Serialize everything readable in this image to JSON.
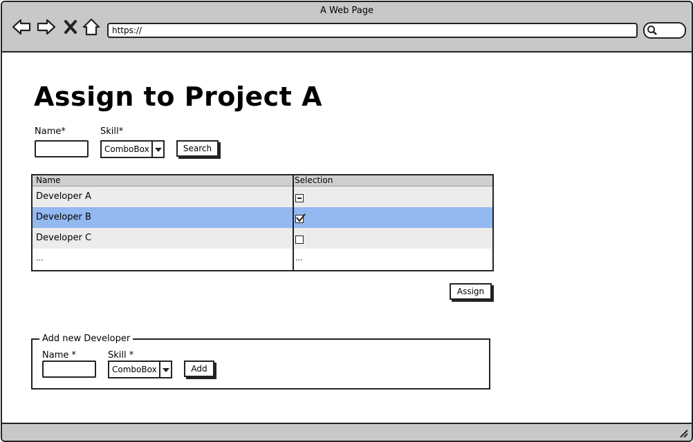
{
  "window": {
    "title": "A Web Page",
    "url": "https://"
  },
  "page": {
    "heading": "Assign to Project A"
  },
  "search": {
    "name_label": "Name*",
    "skill_label": "Skill*",
    "skill_value": "ComboBox",
    "search_label": "Search"
  },
  "table": {
    "columns": [
      "Name",
      "Selection"
    ],
    "rows": [
      {
        "name": "Developer A",
        "selection": "indeterminate",
        "selected": false
      },
      {
        "name": "Developer B",
        "selection": "checked",
        "selected": true
      },
      {
        "name": "Developer C",
        "selection": "unchecked",
        "selected": false
      },
      {
        "name": "...",
        "selection_text": "..."
      }
    ]
  },
  "assign": {
    "label": "Assign"
  },
  "add_developer": {
    "legend": "Add new Developer",
    "name_label": "Name *",
    "skill_label": "Skill *",
    "skill_value": "ComboBox",
    "add_label": "Add"
  },
  "colors": {
    "chrome": "#c8c8c8",
    "selected_row": "#94b8f0",
    "alt_row": "#ececec",
    "header": "#cfcfcf"
  }
}
